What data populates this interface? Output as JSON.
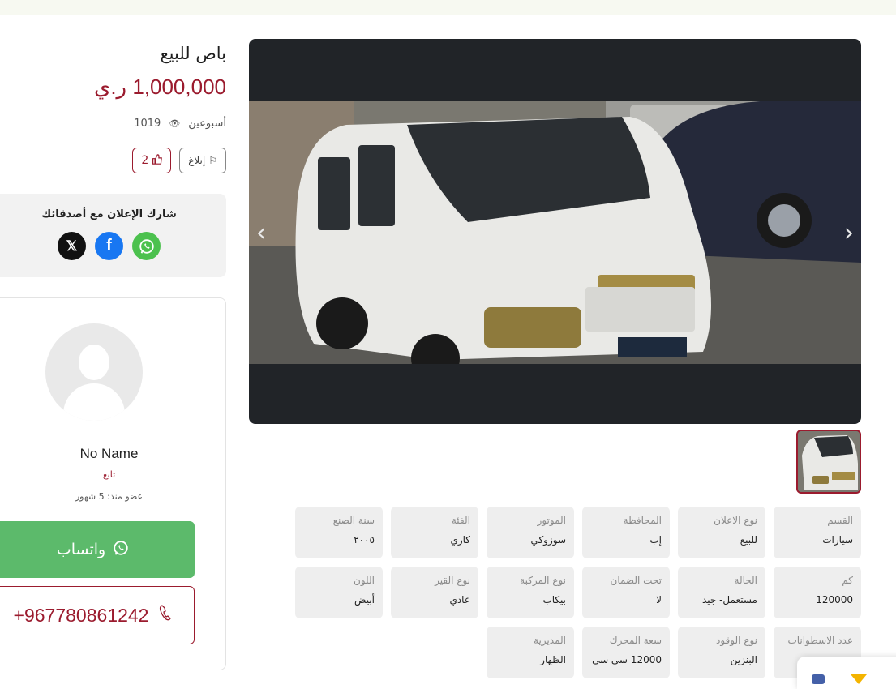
{
  "listing": {
    "title": "باص للبيع",
    "price": "1,000,000 ر.ي",
    "posted": "أسبوعين",
    "views": "1019",
    "report_label": "إبلاغ",
    "likes": "2"
  },
  "share": {
    "title": "شارك الإعلان مع أصدقائك",
    "icons": [
      "x-icon",
      "facebook-icon",
      "whatsapp-icon"
    ]
  },
  "seller": {
    "name": "No Name",
    "type": "تابع",
    "member_since": "عضو منذ: 5 شهور",
    "whatsapp_label": "واتساب",
    "phone": "+967780861242"
  },
  "details": [
    {
      "label": "القسم",
      "value": "سيارات"
    },
    {
      "label": "نوع الاعلان",
      "value": "للبيع"
    },
    {
      "label": "المحافظة",
      "value": "إب"
    },
    {
      "label": "الموتور",
      "value": "سوزوكي"
    },
    {
      "label": "الفئة",
      "value": "كاري"
    },
    {
      "label": "سنة الصنع",
      "value": "٢٠٠٥"
    },
    {
      "label": "كم",
      "value": "120000"
    },
    {
      "label": "الحالة",
      "value": "مستعمل- جيد"
    },
    {
      "label": "تحت الضمان",
      "value": "لا"
    },
    {
      "label": "نوع المركبة",
      "value": "بيكاب"
    },
    {
      "label": "نوع القير",
      "value": "عادي"
    },
    {
      "label": "اللون",
      "value": "أبيض"
    },
    {
      "label": "عدد الاسطوانات",
      "value": ""
    },
    {
      "label": "نوع الوقود",
      "value": "البنزين"
    },
    {
      "label": "سعة المحرك",
      "value": "12000 سى سى"
    },
    {
      "label": "المديرية",
      "value": "الظهار"
    }
  ],
  "colors": {
    "accent": "#9b1b2e",
    "whatsapp": "#5cba6b",
    "gallery_bg": "#212428"
  }
}
